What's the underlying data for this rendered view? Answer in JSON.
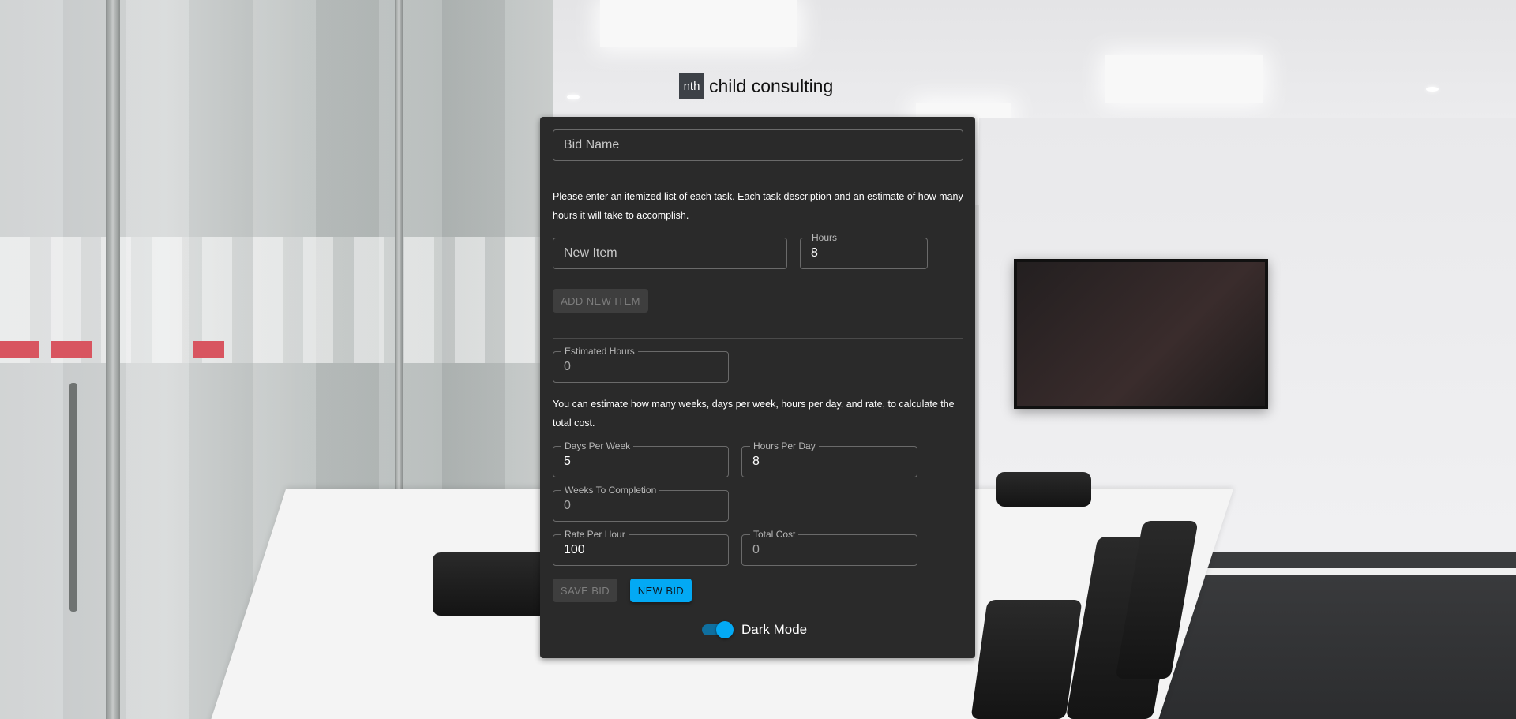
{
  "brand": {
    "logo_mark": "nth",
    "name": "child consulting"
  },
  "form": {
    "bid_name": {
      "placeholder": "Bid Name",
      "value": ""
    },
    "instructions": "Please enter an itemized list of each task. Each task description and an estimate of how many hours it will take to accomplish.",
    "new_item": {
      "placeholder": "New Item",
      "value": ""
    },
    "hours": {
      "label": "Hours",
      "value": "8"
    },
    "add_item_button": "ADD NEW ITEM",
    "estimated_hours": {
      "label": "Estimated Hours",
      "value": "0"
    },
    "estimate_instructions": "You can estimate how many weeks, days per week, hours per day, and rate, to calculate the total cost.",
    "days_per_week": {
      "label": "Days Per Week",
      "value": "5"
    },
    "hours_per_day": {
      "label": "Hours Per Day",
      "value": "8"
    },
    "weeks_to_completion": {
      "label": "Weeks To Completion",
      "value": "0"
    },
    "rate_per_hour": {
      "label": "Rate Per Hour",
      "value": "100"
    },
    "total_cost": {
      "label": "Total Cost",
      "value": "0"
    },
    "save_bid_button": "SAVE BID",
    "new_bid_button": "NEW BID",
    "dark_mode": {
      "label": "Dark Mode",
      "enabled": true
    }
  },
  "colors": {
    "card": "#2a2a2a",
    "accent": "#03a9f4",
    "border": "#6a6a6a"
  }
}
